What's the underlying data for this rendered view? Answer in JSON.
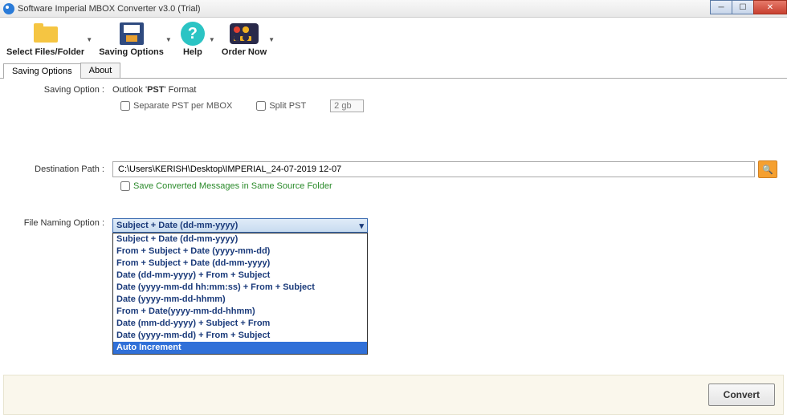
{
  "window": {
    "title": "Software Imperial MBOX Converter v3.0 (Trial)"
  },
  "toolbar": {
    "select_files": "Select Files/Folder",
    "saving_options": "Saving Options",
    "help": "Help",
    "order_now": "Order Now"
  },
  "tabs": {
    "saving_options": "Saving Options",
    "about": "About"
  },
  "labels": {
    "saving_option": "Saving Option :",
    "destination_path": "Destination Path :",
    "file_naming_option": "File Naming Option :"
  },
  "format": {
    "prefix": "Outlook '",
    "bold": "PST",
    "suffix": "' Format"
  },
  "checkboxes": {
    "separate_pst": "Separate PST per MBOX",
    "split_pst": "Split PST",
    "split_size": "2 gb",
    "save_same_folder": "Save Converted Messages in Same Source Folder"
  },
  "destination": {
    "value": "C:\\Users\\KERISH\\Desktop\\IMPERIAL_24-07-2019 12-07"
  },
  "naming": {
    "selected": "Subject + Date (dd-mm-yyyy)",
    "options": [
      "Subject + Date (dd-mm-yyyy)",
      "From + Subject + Date (yyyy-mm-dd)",
      "From + Subject + Date (dd-mm-yyyy)",
      "Date (dd-mm-yyyy) + From + Subject",
      "Date (yyyy-mm-dd hh:mm:ss) + From + Subject",
      "Date (yyyy-mm-dd-hhmm)",
      "From + Date(yyyy-mm-dd-hhmm)",
      "Date (mm-dd-yyyy) + Subject + From",
      "Date (yyyy-mm-dd) + From + Subject",
      "Auto Increment"
    ],
    "highlighted_index": 9
  },
  "footer": {
    "convert": "Convert"
  }
}
